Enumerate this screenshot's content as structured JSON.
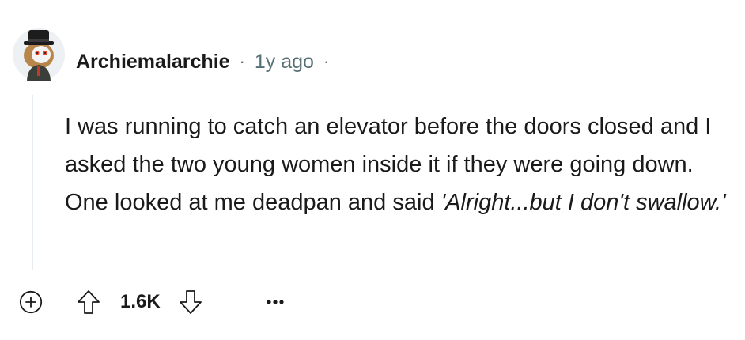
{
  "comment": {
    "username": "Archiemalarchie",
    "separator": "·",
    "time": "1y ago",
    "trailing_separator": "·",
    "body_plain": "I was running to catch an elevator before the doors closed and I asked the two young women inside it if they were going down. One looked at me deadpan and said ",
    "body_quote": "'Alright...but I don't swallow.'",
    "score": "1.6K"
  },
  "icons": {
    "avatar": "avatar-icon",
    "expand": "plus-circle-icon",
    "upvote": "upvote-arrow-icon",
    "downvote": "downvote-arrow-icon",
    "more": "overflow-menu-icon"
  },
  "colors": {
    "text_primary": "#1a1a1b",
    "text_secondary": "#576f76",
    "thread_line": "#e5ebee",
    "avatar_bg": "#eef1f4"
  }
}
